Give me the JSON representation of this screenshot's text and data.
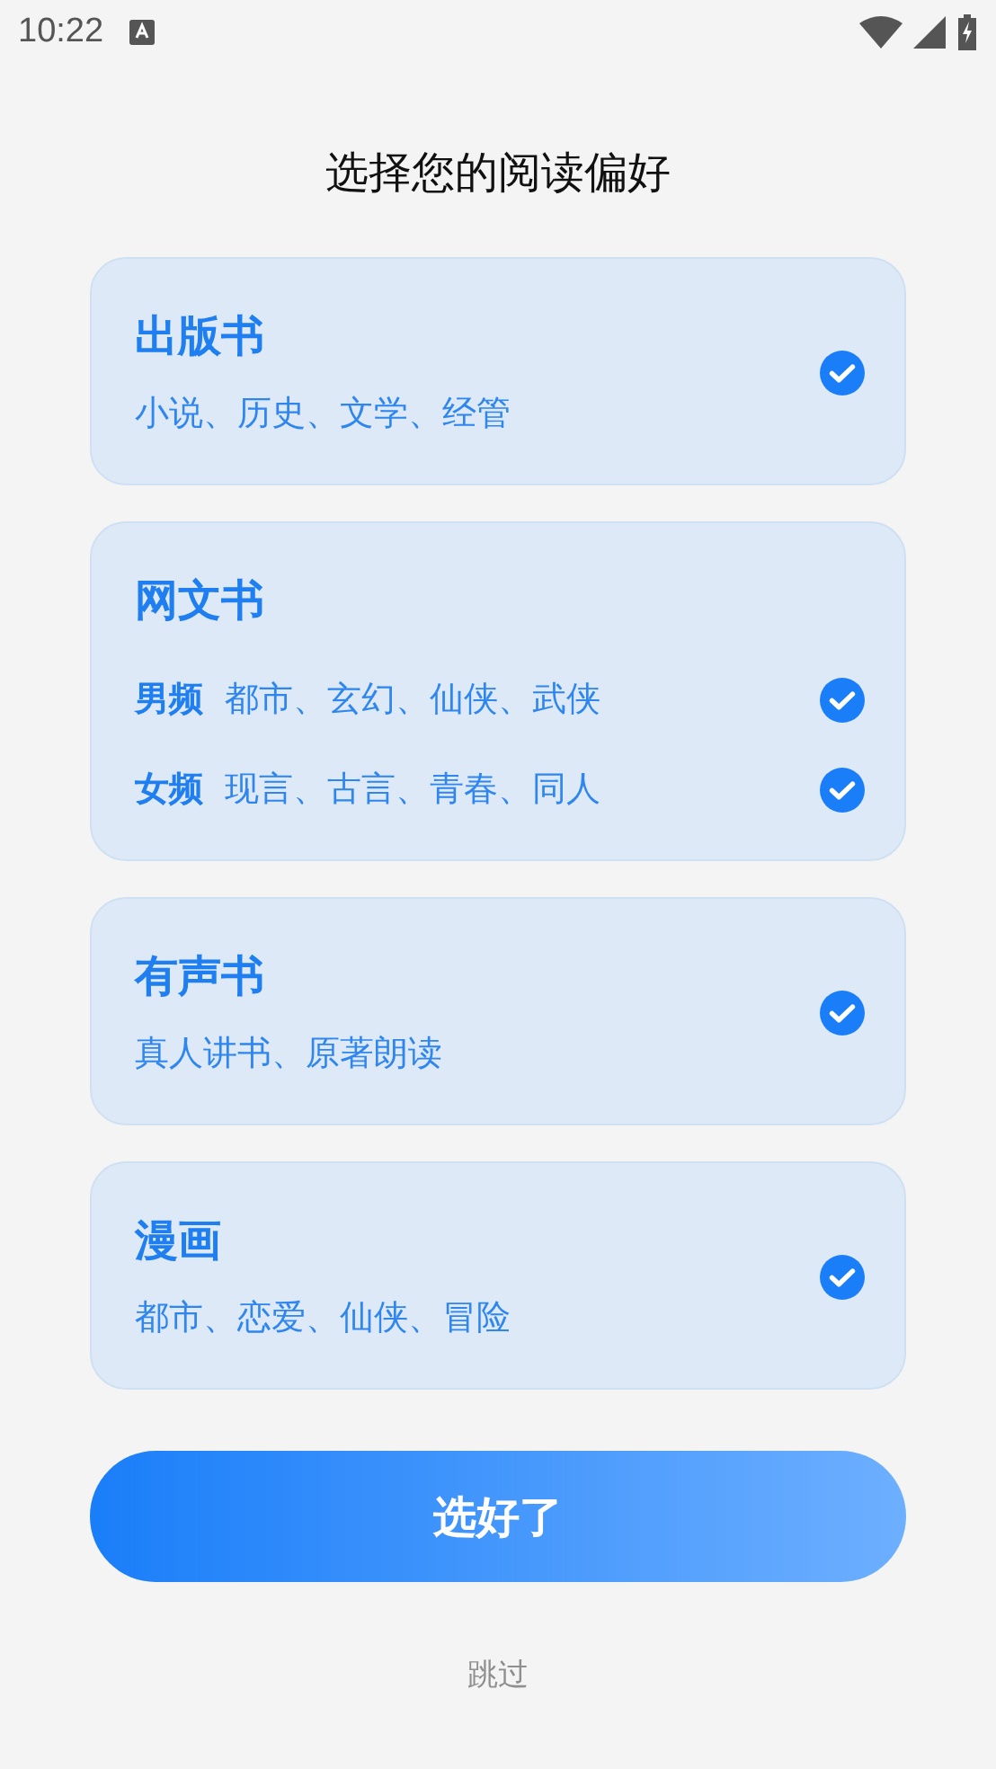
{
  "status_bar": {
    "time": "10:22"
  },
  "title": "选择您的阅读偏好",
  "cards": [
    {
      "kind": "simple",
      "title": "出版书",
      "description": "小说、历史、文学、经管",
      "checked": true
    },
    {
      "kind": "split",
      "title": "网文书",
      "rows": [
        {
          "label": "男频",
          "description": "都市、玄幻、仙侠、武侠",
          "checked": true
        },
        {
          "label": "女频",
          "description": "现言、古言、青春、同人",
          "checked": true
        }
      ]
    },
    {
      "kind": "simple",
      "title": "有声书",
      "description": "真人讲书、原著朗读",
      "checked": true
    },
    {
      "kind": "simple",
      "title": "漫画",
      "description": "都市、恋爱、仙侠、冒险",
      "checked": true
    }
  ],
  "confirm_button": "选好了",
  "skip_link": "跳过"
}
